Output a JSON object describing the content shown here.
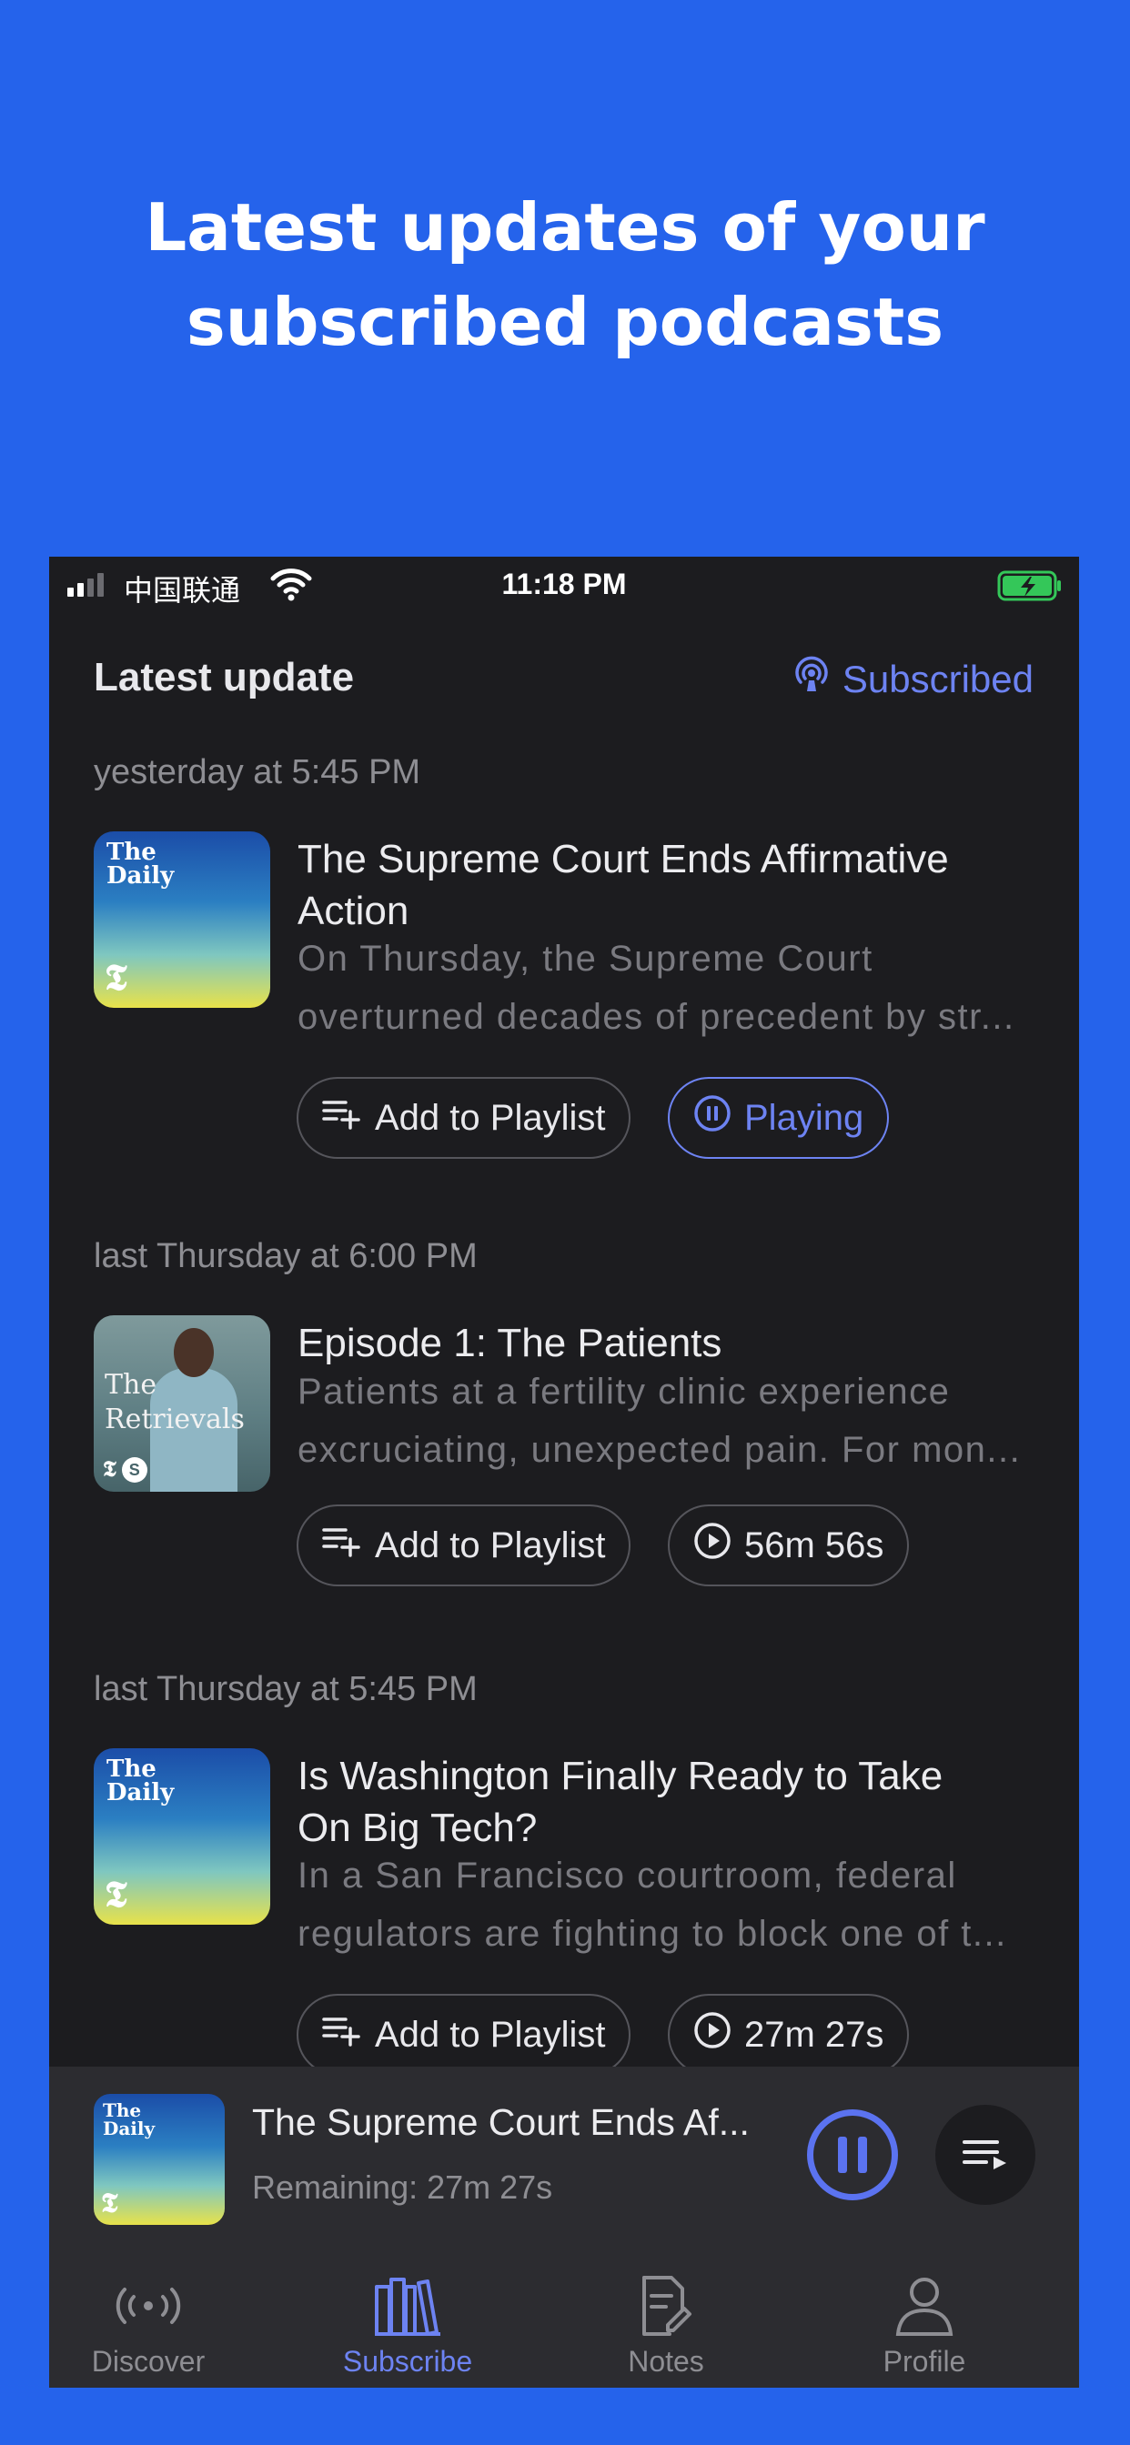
{
  "promo": {
    "headline_line1": "Latest updates of your",
    "headline_line2": "subscribed podcasts"
  },
  "status_bar": {
    "carrier": "中国联通",
    "time": "11:18 PM",
    "signal_bars_active": 2,
    "battery_state": "charging"
  },
  "header": {
    "title": "Latest update",
    "subscribed_label": "Subscribed",
    "subscribed_icon": "podcast-icon"
  },
  "colors": {
    "background": "#2563EB",
    "phone_bg": "#1C1C1F",
    "accent": "#6D83F2",
    "battery_green": "#34C759"
  },
  "episodes": [
    {
      "time": "yesterday at 5:45 PM",
      "artwork": "The Daily",
      "artwork_brand": "The\nDaily",
      "title_lines": [
        "The Supreme Court Ends Affirmative",
        "Action"
      ],
      "desc_lines": [
        "On Thursday, the Supreme Court",
        "overturned decades of precedent by str..."
      ],
      "playlist_label": "Add to Playlist",
      "status_label": "Playing",
      "status_icon": "pause-circle-icon"
    },
    {
      "time": "last Thursday at 6:00 PM",
      "artwork": "The Retrievals",
      "artwork_title_lines": [
        "The",
        "Retrievals"
      ],
      "title_lines": [
        "Episode 1: The Patients"
      ],
      "desc_lines": [
        "Patients at a fertility clinic experience",
        "excruciating, unexpected pain. For mon..."
      ],
      "playlist_label": "Add to Playlist",
      "status_label": "56m 56s",
      "status_icon": "play-circle-icon"
    },
    {
      "time": "last Thursday at 5:45 PM",
      "artwork": "The Daily",
      "artwork_brand": "The\nDaily",
      "title_lines": [
        "Is Washington Finally Ready to Take",
        "On Big Tech?"
      ],
      "desc_lines": [
        "In a San Francisco courtroom, federal",
        "regulators are fighting to block one of t..."
      ],
      "playlist_label": "Add to Playlist",
      "status_label": "27m 27s",
      "status_icon": "play-circle-icon"
    }
  ],
  "mini_player": {
    "title": "The Supreme Court Ends Af...",
    "remaining": "Remaining: 27m 27s",
    "artwork_brand": "The\nDaily"
  },
  "tabs": [
    {
      "label": "Discover",
      "icon": "broadcast-icon",
      "active": false
    },
    {
      "label": "Subscribe",
      "icon": "library-icon",
      "active": true
    },
    {
      "label": "Notes",
      "icon": "note-edit-icon",
      "active": false
    },
    {
      "label": "Profile",
      "icon": "person-icon",
      "active": false
    }
  ]
}
